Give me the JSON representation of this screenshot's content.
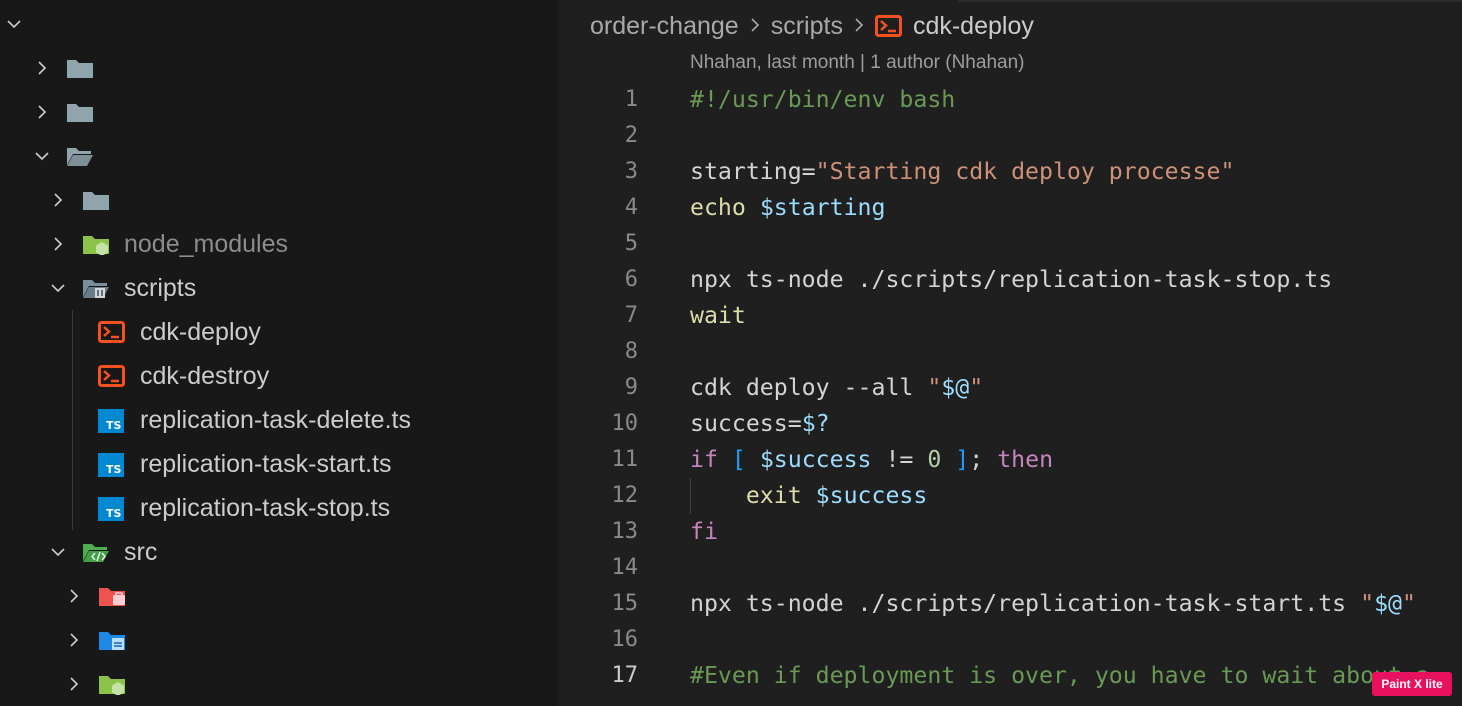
{
  "colors": {
    "sidebar_bg": "#181818",
    "editor_bg": "#1f1f1f",
    "folder_icon": "#90a4ae",
    "node_folder_icon": "#8bc34a",
    "script_icon": "#f4511e",
    "ts_icon": "#0288d1",
    "src_folder_icon": "#4caf50",
    "badge_bg": "#e8115e"
  },
  "sidebar": {
    "items": [
      {
        "label": "",
        "icon": "chevron-down-icon"
      },
      {
        "label": "",
        "icon": "folder-icon"
      },
      {
        "label": "",
        "icon": "folder-icon"
      },
      {
        "label": "",
        "icon": "folder-open-icon"
      },
      {
        "label": "",
        "icon": "folder-icon"
      },
      {
        "label": "node_modules",
        "icon": "node-folder-icon"
      },
      {
        "label": "scripts",
        "icon": "scripts-folder-icon"
      },
      {
        "label": "cdk-deploy",
        "icon": "terminal-icon"
      },
      {
        "label": "cdk-destroy",
        "icon": "terminal-icon"
      },
      {
        "label": "replication-task-delete.ts",
        "icon": "typescript-icon"
      },
      {
        "label": "replication-task-start.ts",
        "icon": "typescript-icon"
      },
      {
        "label": "replication-task-stop.ts",
        "icon": "typescript-icon"
      },
      {
        "label": "src",
        "icon": "src-folder-icon"
      },
      {
        "label": "",
        "icon": "red-folder-icon"
      },
      {
        "label": "",
        "icon": "blue-folder-icon"
      },
      {
        "label": "",
        "icon": "green-folder-icon"
      }
    ]
  },
  "editor": {
    "breadcrumb": [
      "order-change",
      "scripts",
      "cdk-deploy"
    ],
    "codelens": "Nhahan, last month | 1 author (Nhahan)",
    "active_line": 17,
    "lines": [
      {
        "n": "1",
        "tokens": [
          {
            "t": "#!/usr/bin/env bash",
            "c": "comment"
          }
        ]
      },
      {
        "n": "2",
        "tokens": []
      },
      {
        "n": "3",
        "tokens": [
          {
            "t": "starting=",
            "c": "plain"
          },
          {
            "t": "\"Starting cdk deploy processe\"",
            "c": "string"
          }
        ]
      },
      {
        "n": "4",
        "tokens": [
          {
            "t": "echo",
            "c": "func"
          },
          {
            "t": " ",
            "c": "plain"
          },
          {
            "t": "$starting",
            "c": "var"
          }
        ]
      },
      {
        "n": "5",
        "tokens": []
      },
      {
        "n": "6",
        "tokens": [
          {
            "t": "npx ts-node ./scripts/replication-task-stop.ts",
            "c": "plain"
          }
        ]
      },
      {
        "n": "7",
        "tokens": [
          {
            "t": "wait",
            "c": "func"
          }
        ]
      },
      {
        "n": "8",
        "tokens": []
      },
      {
        "n": "9",
        "tokens": [
          {
            "t": "cdk deploy --all ",
            "c": "plain"
          },
          {
            "t": "\"",
            "c": "string"
          },
          {
            "t": "$@",
            "c": "var"
          },
          {
            "t": "\"",
            "c": "string"
          }
        ]
      },
      {
        "n": "10",
        "tokens": [
          {
            "t": "success=",
            "c": "plain"
          },
          {
            "t": "$?",
            "c": "var"
          }
        ]
      },
      {
        "n": "11",
        "tokens": [
          {
            "t": "if",
            "c": "keyword"
          },
          {
            "t": " ",
            "c": "plain"
          },
          {
            "t": "[",
            "c": "bracket"
          },
          {
            "t": " ",
            "c": "plain"
          },
          {
            "t": "$success",
            "c": "var"
          },
          {
            "t": " != ",
            "c": "plain"
          },
          {
            "t": "0",
            "c": "number"
          },
          {
            "t": " ",
            "c": "plain"
          },
          {
            "t": "]",
            "c": "bracket"
          },
          {
            "t": "; ",
            "c": "plain"
          },
          {
            "t": "then",
            "c": "keyword"
          }
        ]
      },
      {
        "n": "12",
        "tokens": [
          {
            "t": "    ",
            "c": "plain"
          },
          {
            "t": "exit",
            "c": "func"
          },
          {
            "t": " ",
            "c": "plain"
          },
          {
            "t": "$success",
            "c": "var"
          }
        ]
      },
      {
        "n": "13",
        "tokens": [
          {
            "t": "fi",
            "c": "keyword"
          }
        ]
      },
      {
        "n": "14",
        "tokens": []
      },
      {
        "n": "15",
        "tokens": [
          {
            "t": "npx ts-node ./scripts/replication-task-start.ts ",
            "c": "plain"
          },
          {
            "t": "\"",
            "c": "string"
          },
          {
            "t": "$@",
            "c": "var"
          },
          {
            "t": "\"",
            "c": "string"
          }
        ]
      },
      {
        "n": "16",
        "tokens": []
      },
      {
        "n": "17",
        "tokens": [
          {
            "t": "#Even if deployment is over, you have to wait about a",
            "c": "comment"
          }
        ]
      }
    ]
  },
  "badge": {
    "label": "Paint X lite"
  }
}
